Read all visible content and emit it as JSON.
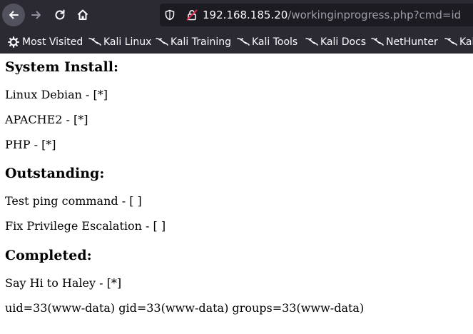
{
  "toolbar": {
    "back_icon": "arrow-left-icon",
    "forward_icon": "arrow-right-icon",
    "reload_icon": "reload-icon",
    "home_icon": "home-icon"
  },
  "url": {
    "host": "192.168.185.20",
    "path": "/workinginprogress.php?cmd=id"
  },
  "bookmarks": [
    {
      "label": "Most Visited",
      "icon": "gear-icon"
    },
    {
      "label": "Kali Linux",
      "icon": "kali-dragon-icon"
    },
    {
      "label": "Kali Training",
      "icon": "kali-dragon-icon"
    },
    {
      "label": "Kali Tools",
      "icon": "kali-dragon-icon"
    },
    {
      "label": "Kali Docs",
      "icon": "kali-dragon-icon"
    },
    {
      "label": "NetHunter",
      "icon": "kali-dragon-icon"
    },
    {
      "label": "Kal",
      "icon": "kali-dragon-icon"
    }
  ],
  "page": {
    "install_heading": "System Install:",
    "install_items": [
      "Linux Debian - [*]",
      "APACHE2 - [*]",
      "PHP - [*]"
    ],
    "outstanding_heading": "Outstanding:",
    "outstanding_items": [
      "Test ping command - [ ]",
      "Fix Privilege Escalation - [ ]"
    ],
    "completed_heading": "Completed:",
    "completed_items": [
      "Say Hi to Haley - [*]"
    ],
    "command_output": "uid=33(www-data) gid=33(www-data) groups=33(www-data)"
  },
  "colors": {
    "chrome_bg": "#2b2a33",
    "urlbar_bg": "#1c1b22",
    "url_host": "#fbfbfe",
    "url_path": "#9e9ea6"
  }
}
